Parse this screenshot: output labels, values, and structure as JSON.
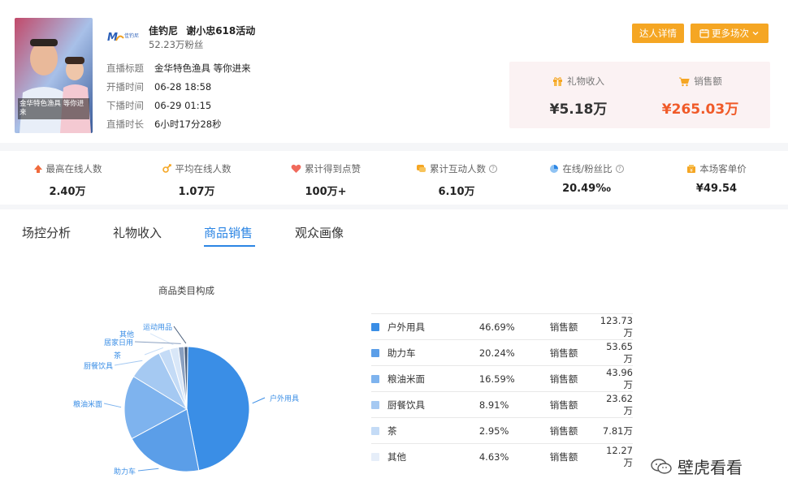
{
  "streamer": {
    "name": "佳钓尼",
    "event": "谢小忠618活动",
    "fans": "52.23万粉丝",
    "logo_text": "佳钓尼",
    "video_caption": "金华特色渔具 等你进来",
    "info": [
      {
        "key": "直播标题",
        "value": "金华特色渔具 等你进来"
      },
      {
        "key": "开播时间",
        "value": "06-28 18:58"
      },
      {
        "key": "下播时间",
        "value": "06-29 01:15"
      },
      {
        "key": "直播时长",
        "value": "6小时17分28秒"
      }
    ]
  },
  "actions": {
    "detail_label": "达人详情",
    "more_label": "更多场次"
  },
  "revenue": {
    "gift": {
      "label": "礼物收入",
      "value": "¥5.18万",
      "icon": "gift-icon"
    },
    "sales": {
      "label": "销售额",
      "value": "¥265.03万",
      "icon": "cart-icon",
      "color": "#f05a28"
    }
  },
  "stats": [
    {
      "label": "最高在线人数",
      "value": "2.40万",
      "icon": "peak-icon",
      "help": false
    },
    {
      "label": "平均在线人数",
      "value": "1.07万",
      "icon": "average-icon",
      "help": false
    },
    {
      "label": "累计得到点赞",
      "value": "100万+",
      "icon": "heart-icon",
      "help": false
    },
    {
      "label": "累计互动人数",
      "value": "6.10万",
      "icon": "chat-icon",
      "help": true
    },
    {
      "label": "在线/粉丝比",
      "value": "20.49‰",
      "icon": "pie-icon",
      "help": true
    },
    {
      "label": "本场客单价",
      "value": "¥49.54",
      "icon": "wallet-icon",
      "help": false
    }
  ],
  "tabs": [
    {
      "label": "场控分析",
      "active": false
    },
    {
      "label": "礼物收入",
      "active": false
    },
    {
      "label": "商品销售",
      "active": true
    },
    {
      "label": "观众画像",
      "active": false
    }
  ],
  "colors": {
    "accent": "#2b85e4",
    "button": "#f5a623",
    "sales": "#f05a28"
  },
  "chart_data": {
    "type": "pie",
    "title": "商品类目构成",
    "categories": [
      "户外用具",
      "助力车",
      "粮油米面",
      "厨餐饮具",
      "茶",
      "其他",
      "居家日用",
      "运动用品"
    ],
    "values": [
      46.69,
      20.24,
      16.59,
      8.91,
      2.95,
      2.2,
      1.5,
      0.93
    ],
    "colors": [
      "#3a8ee6",
      "#5b9ee8",
      "#7eb3ee",
      "#a5c9f2",
      "#c4dbf6",
      "#d9e7f8",
      "#8aa0c0",
      "#465b78"
    ],
    "slice_labels": [
      "户外用具",
      "助力车",
      "粮油米面",
      "厨餐饮具",
      "茶",
      "其他",
      "居家日用",
      "运动用品"
    ]
  },
  "legend": [
    {
      "name": "户外用具",
      "pct": "46.69%",
      "metric": "销售额",
      "amount": "123.73万",
      "color": "#3a8ee6"
    },
    {
      "name": "助力车",
      "pct": "20.24%",
      "metric": "销售额",
      "amount": "53.65万",
      "color": "#5b9ee8"
    },
    {
      "name": "粮油米面",
      "pct": "16.59%",
      "metric": "销售额",
      "amount": "43.96万",
      "color": "#7eb3ee"
    },
    {
      "name": "厨餐饮具",
      "pct": "8.91%",
      "metric": "销售额",
      "amount": "23.62万",
      "color": "#a5c9f2"
    },
    {
      "name": "茶",
      "pct": "2.95%",
      "metric": "销售额",
      "amount": "7.81万",
      "color": "#c4dbf6"
    },
    {
      "name": "其他",
      "pct": "4.63%",
      "metric": "销售额",
      "amount": "12.27万",
      "color": "#e6eef9"
    }
  ],
  "watermark": "壁虎看看"
}
